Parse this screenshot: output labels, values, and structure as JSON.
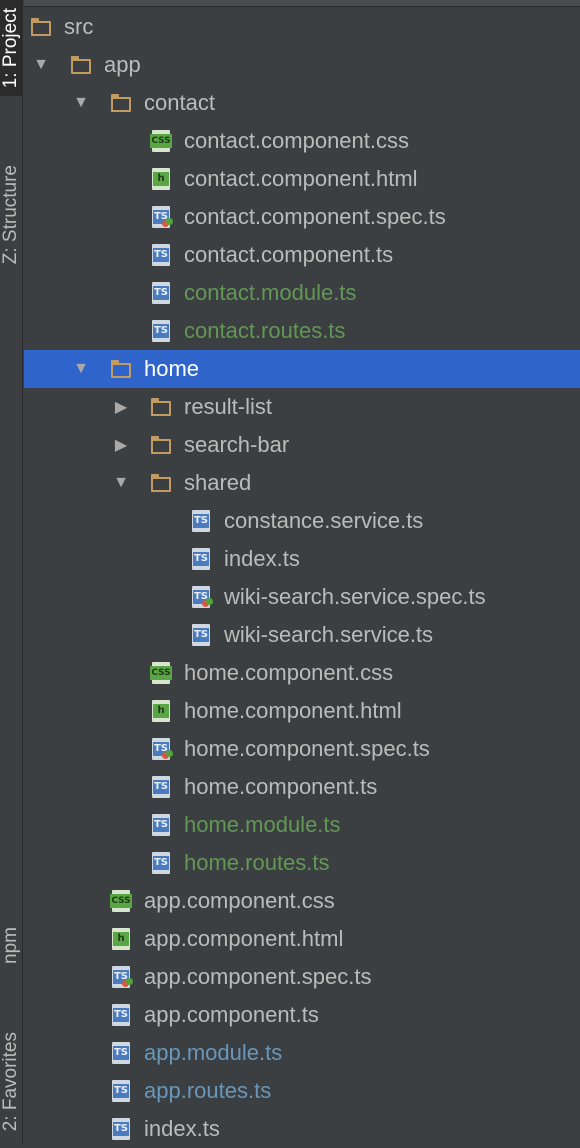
{
  "side_tabs": [
    {
      "name": "project-tab",
      "label": "1: Project",
      "active": true
    },
    {
      "name": "structure-tab",
      "label": "Z: Structure",
      "active": false
    },
    {
      "name": "npm-tab",
      "label": "npm",
      "active": false
    },
    {
      "name": "favorites-tab",
      "label": "2: Favorites",
      "active": false
    }
  ],
  "tree": [
    {
      "label": "src",
      "type": "folder",
      "depth": 0,
      "expanded": null,
      "color": "default"
    },
    {
      "label": "app",
      "type": "folder",
      "depth": 1,
      "expanded": true,
      "color": "default"
    },
    {
      "label": "contact",
      "type": "folder",
      "depth": 2,
      "expanded": true,
      "color": "default"
    },
    {
      "label": "contact.component.css",
      "type": "css",
      "depth": 3,
      "color": "default"
    },
    {
      "label": "contact.component.html",
      "type": "html",
      "depth": 3,
      "color": "default"
    },
    {
      "label": "contact.component.spec.ts",
      "type": "spec",
      "depth": 3,
      "color": "default"
    },
    {
      "label": "contact.component.ts",
      "type": "ts",
      "depth": 3,
      "color": "default"
    },
    {
      "label": "contact.module.ts",
      "type": "ts",
      "depth": 3,
      "color": "green"
    },
    {
      "label": "contact.routes.ts",
      "type": "ts",
      "depth": 3,
      "color": "green"
    },
    {
      "label": "home",
      "type": "folder",
      "depth": 2,
      "expanded": true,
      "color": "white",
      "selected": true
    },
    {
      "label": "result-list",
      "type": "folder",
      "depth": 3,
      "expanded": false,
      "color": "default"
    },
    {
      "label": "search-bar",
      "type": "folder",
      "depth": 3,
      "expanded": false,
      "color": "default"
    },
    {
      "label": "shared",
      "type": "folder",
      "depth": 3,
      "expanded": true,
      "color": "default"
    },
    {
      "label": "constance.service.ts",
      "type": "ts",
      "depth": 4,
      "color": "default"
    },
    {
      "label": "index.ts",
      "type": "ts",
      "depth": 4,
      "color": "default"
    },
    {
      "label": "wiki-search.service.spec.ts",
      "type": "spec",
      "depth": 4,
      "color": "default"
    },
    {
      "label": "wiki-search.service.ts",
      "type": "ts",
      "depth": 4,
      "color": "default"
    },
    {
      "label": "home.component.css",
      "type": "css",
      "depth": 3,
      "color": "default"
    },
    {
      "label": "home.component.html",
      "type": "html",
      "depth": 3,
      "color": "default"
    },
    {
      "label": "home.component.spec.ts",
      "type": "spec",
      "depth": 3,
      "color": "default"
    },
    {
      "label": "home.component.ts",
      "type": "ts",
      "depth": 3,
      "color": "default"
    },
    {
      "label": "home.module.ts",
      "type": "ts",
      "depth": 3,
      "color": "green"
    },
    {
      "label": "home.routes.ts",
      "type": "ts",
      "depth": 3,
      "color": "green"
    },
    {
      "label": "app.component.css",
      "type": "css",
      "depth": 2,
      "color": "default"
    },
    {
      "label": "app.component.html",
      "type": "html",
      "depth": 2,
      "color": "default"
    },
    {
      "label": "app.component.spec.ts",
      "type": "spec",
      "depth": 2,
      "color": "default"
    },
    {
      "label": "app.component.ts",
      "type": "ts",
      "depth": 2,
      "color": "default"
    },
    {
      "label": "app.module.ts",
      "type": "ts",
      "depth": 2,
      "color": "blue"
    },
    {
      "label": "app.routes.ts",
      "type": "ts",
      "depth": 2,
      "color": "blue"
    },
    {
      "label": "index.ts",
      "type": "ts",
      "depth": 2,
      "color": "default"
    }
  ],
  "icon_badges": {
    "ts": "TS",
    "css": "CSS",
    "html": "h",
    "spec": "TS"
  },
  "colors": {
    "selection": "#2f65ca",
    "green_text": "#629755",
    "blue_text": "#6897bb",
    "folder": "#c29b62"
  }
}
